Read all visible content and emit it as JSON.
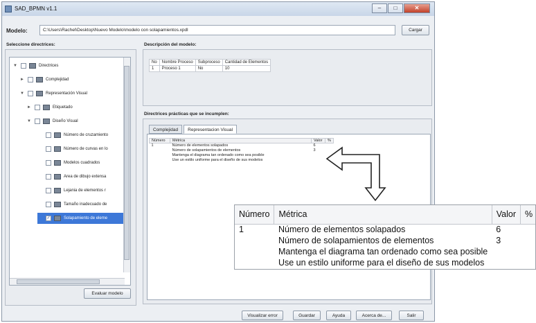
{
  "window": {
    "title": "SAD_BPMN v1.1",
    "minimize": "–",
    "maximize": "□",
    "close": "✕"
  },
  "model": {
    "label": "Modelo:",
    "path": "C:\\Users\\Rachel\\Desktop\\Nuevo Modelo\\modelo con solapamientos.xpdl",
    "load_button": "Cargar"
  },
  "directives": {
    "label": "Seleccione directrices:",
    "tree": [
      {
        "label": "Directrices",
        "expand": "▼",
        "checked": false
      },
      {
        "label": "Complejidad",
        "expand": "►",
        "checked": false
      },
      {
        "label": "Representación Visual",
        "expand": "▼",
        "checked": false
      },
      {
        "label": "Etiquetado",
        "expand": "►",
        "checked": false
      },
      {
        "label": "Diseño Visual",
        "expand": "▼",
        "checked": false
      },
      {
        "label": "Número de cruzamiento",
        "expand": "",
        "checked": false
      },
      {
        "label": "Número de curvas en lo",
        "expand": "",
        "checked": false
      },
      {
        "label": "Modelos cuadrados",
        "expand": "",
        "checked": false
      },
      {
        "label": "Area de dibujo extensa",
        "expand": "",
        "checked": false
      },
      {
        "label": "Lejania de elementos r",
        "expand": "",
        "checked": false
      },
      {
        "label": "Tamaño inadecuado de",
        "expand": "",
        "checked": false
      },
      {
        "label": "Solapamiento de eleme",
        "expand": "",
        "checked": true
      }
    ],
    "evaluate_button": "Evaluar modelo"
  },
  "description": {
    "label": "Descripción del modelo:",
    "headers": [
      "No",
      "Nombre Proceso",
      "Subproceso",
      "Cantidad de Elementos"
    ],
    "rows": [
      [
        "1",
        "Proceso 1",
        "No",
        "10"
      ]
    ]
  },
  "practices": {
    "label": "Directrices prácticas que se incumplen:",
    "tabs": [
      "Complejidad",
      "Representacion Visual"
    ],
    "active_tab": 1,
    "headers": [
      "Número",
      "Métrica",
      "Valor",
      "%"
    ],
    "rows": [
      [
        "1",
        "Número de elementos solapados",
        "6",
        ""
      ],
      [
        "",
        "Número de solapamientos de elementos",
        "3",
        ""
      ],
      [
        "",
        "Mantenga el diagrama tan ordenado como sea posible",
        "",
        ""
      ],
      [
        "",
        "Use un estilo uniforme para el diseño de sus modelos",
        "",
        ""
      ]
    ]
  },
  "footer_buttons": [
    "Visualizar error",
    "Guardar",
    "Ayuda",
    "Acerca de...",
    "Salir"
  ],
  "zoom": {
    "headers": [
      "Número",
      "Métrica",
      "Valor",
      "%"
    ],
    "rows": [
      [
        "1",
        "Número de elementos solapados",
        "6",
        ""
      ],
      [
        "",
        "Número de solapamientos de elementos",
        "3",
        ""
      ],
      [
        "",
        "Mantenga el diagrama tan ordenado como sea posible",
        "",
        ""
      ],
      [
        "",
        "Use un estilo uniforme para el diseño de sus modelos",
        "",
        ""
      ]
    ]
  },
  "colors": {
    "selection": "#3d78d8",
    "close_button": "#c2412a",
    "arrow": "#222222"
  }
}
